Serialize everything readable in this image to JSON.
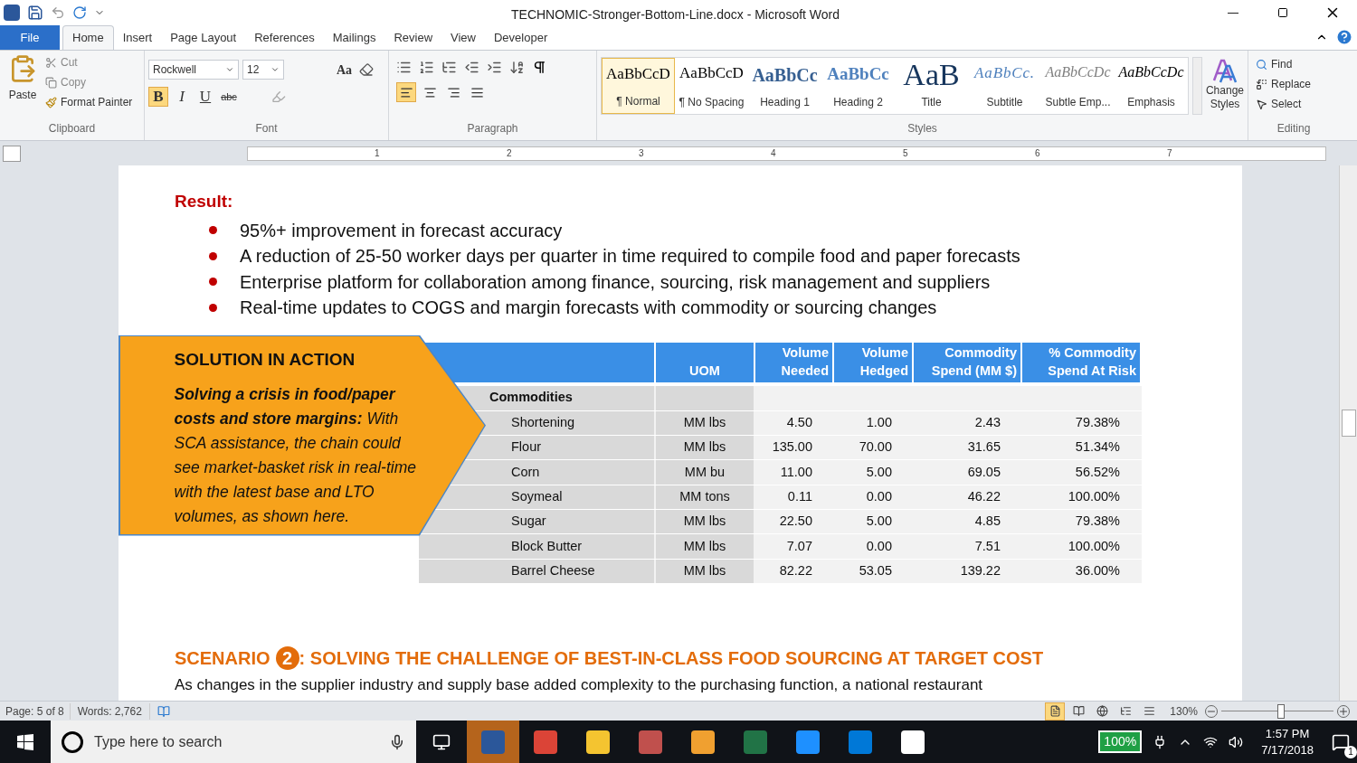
{
  "window": {
    "title": "TECHNOMIC-Stronger-Bottom-Line.docx - Microsoft Word"
  },
  "ribbon_tabs": [
    {
      "label": "File",
      "kind": "file",
      "selected": false
    },
    {
      "label": "Home",
      "kind": "tab",
      "selected": true
    },
    {
      "label": "Insert",
      "kind": "tab",
      "selected": false
    },
    {
      "label": "Page Layout",
      "kind": "tab",
      "selected": false
    },
    {
      "label": "References",
      "kind": "tab",
      "selected": false
    },
    {
      "label": "Mailings",
      "kind": "tab",
      "selected": false
    },
    {
      "label": "Review",
      "kind": "tab",
      "selected": false
    },
    {
      "label": "View",
      "kind": "tab",
      "selected": false
    },
    {
      "label": "Developer",
      "kind": "tab",
      "selected": false
    }
  ],
  "clipboard": {
    "paste": "Paste",
    "cut": "Cut",
    "copy": "Copy",
    "format_painter": "Format Painter",
    "label": "Clipboard"
  },
  "font": {
    "name": "Rockwell",
    "size": "12",
    "label": "Font",
    "change_case": "Aa",
    "formats": [
      {
        "label": "B",
        "kind": "bold",
        "selected": true
      },
      {
        "label": "I",
        "kind": "italic",
        "selected": false
      },
      {
        "label": "U",
        "kind": "underline",
        "selected": false
      },
      {
        "label": "abc",
        "kind": "strike",
        "selected": false
      }
    ]
  },
  "paragraph": {
    "label": "Paragraph",
    "alignments": [
      {
        "kind": "left",
        "selected": true
      },
      {
        "kind": "center",
        "selected": false
      },
      {
        "kind": "right",
        "selected": false
      },
      {
        "kind": "justify",
        "selected": false
      }
    ]
  },
  "styles": {
    "label": "Styles",
    "change_styles": "Change Styles",
    "items": [
      {
        "sample": "AaBbCcD",
        "label": "¶ Normal",
        "kind": "normal",
        "selected": true
      },
      {
        "sample": "AaBbCcD",
        "label": "¶ No Spacing",
        "kind": "normal",
        "selected": false
      },
      {
        "sample": "AaBbCc",
        "label": "Heading 1",
        "kind": "heading1",
        "selected": false
      },
      {
        "sample": "AaBbCc",
        "label": "Heading 2",
        "kind": "heading2",
        "selected": false
      },
      {
        "sample": "AaB",
        "label": "Title",
        "kind": "title",
        "selected": false
      },
      {
        "sample": "AaBbCc.",
        "label": "Subtitle",
        "kind": "subtitle",
        "selected": false
      },
      {
        "sample": "AaBbCcDc",
        "label": "Subtle Emp...",
        "kind": "subtle",
        "selected": false
      },
      {
        "sample": "AaBbCcDc",
        "label": "Emphasis",
        "kind": "emphasis",
        "selected": false
      }
    ]
  },
  "editing": {
    "label": "Editing",
    "find": "Find",
    "replace": "Replace",
    "select": "Select"
  },
  "ruler": {
    "numbers": [
      "1",
      "2",
      "3",
      "4",
      "5",
      "6",
      "7"
    ]
  },
  "document": {
    "result_heading": "Result:",
    "bullets": [
      "95%+ improvement in forecast accuracy",
      "A reduction of 25-50 worker days per quarter in time required to compile food and paper forecasts",
      "Enterprise platform for collaboration among finance, sourcing, risk management and suppliers",
      "Real-time updates to COGS and margin forecasts with commodity or sourcing changes"
    ],
    "callout": {
      "title": "SOLUTION IN ACTION",
      "body": "**Solving a crisis in food/paper costs and store margins:** With SCA assistance, the chain could see market-basket risk in real-time with the latest base and LTO volumes, as shown here."
    },
    "table": {
      "columns": [
        "",
        "UOM",
        "Volume Needed",
        "Volume Hedged",
        "Commodity Spend (MM $)",
        "% Commodity Spend At Risk"
      ],
      "group": "Commodities",
      "rows": [
        [
          "Shortening",
          "MM lbs",
          "4.50",
          "1.00",
          "2.43",
          "79.38%"
        ],
        [
          "Flour",
          "MM lbs",
          "135.00",
          "70.00",
          "31.65",
          "51.34%"
        ],
        [
          "Corn",
          "MM bu",
          "11.00",
          "5.00",
          "69.05",
          "56.52%"
        ],
        [
          "Soymeal",
          "MM tons",
          "0.11",
          "0.00",
          "46.22",
          "100.00%"
        ],
        [
          "Sugar",
          "MM lbs",
          "22.50",
          "5.00",
          "4.85",
          "79.38%"
        ],
        [
          "Block Butter",
          "MM lbs",
          "7.07",
          "0.00",
          "7.51",
          "100.00%"
        ],
        [
          "Barrel Cheese",
          "MM lbs",
          "82.22",
          "53.05",
          "139.22",
          "36.00%"
        ]
      ]
    },
    "scenario": {
      "prefix": "SCENARIO",
      "number": "2",
      "title": ": SOLVING THE CHALLENGE OF BEST-IN-CLASS FOOD SOURCING AT TARGET COST"
    },
    "last_line": "As changes in the supplier industry and supply base added complexity to the purchasing function, a national restaurant"
  },
  "status_bar": {
    "page": "Page: 5 of 8",
    "words": "Words: 2,762",
    "zoom": "130%",
    "zoom_slider": {
      "level": 0.53
    },
    "views": [
      {
        "kind": "print",
        "selected": true
      },
      {
        "kind": "reading",
        "selected": false
      },
      {
        "kind": "web",
        "selected": false
      },
      {
        "kind": "outline",
        "selected": false
      },
      {
        "kind": "draft",
        "selected": false
      }
    ]
  },
  "taskbar": {
    "search_placeholder": "Type here to search",
    "apps": [
      {
        "kind": "word",
        "selected": true
      },
      {
        "kind": "chrome",
        "selected": false
      },
      {
        "kind": "explorer",
        "selected": false
      },
      {
        "kind": "snip",
        "selected": false
      },
      {
        "kind": "outlook",
        "selected": false
      },
      {
        "kind": "excel",
        "selected": false
      },
      {
        "kind": "ie",
        "selected": false
      },
      {
        "kind": "edge",
        "selected": false
      },
      {
        "kind": "zip",
        "selected": false
      }
    ],
    "battery": "100%",
    "time": "1:57 PM",
    "date": "7/17/2018",
    "notifications": "1"
  }
}
